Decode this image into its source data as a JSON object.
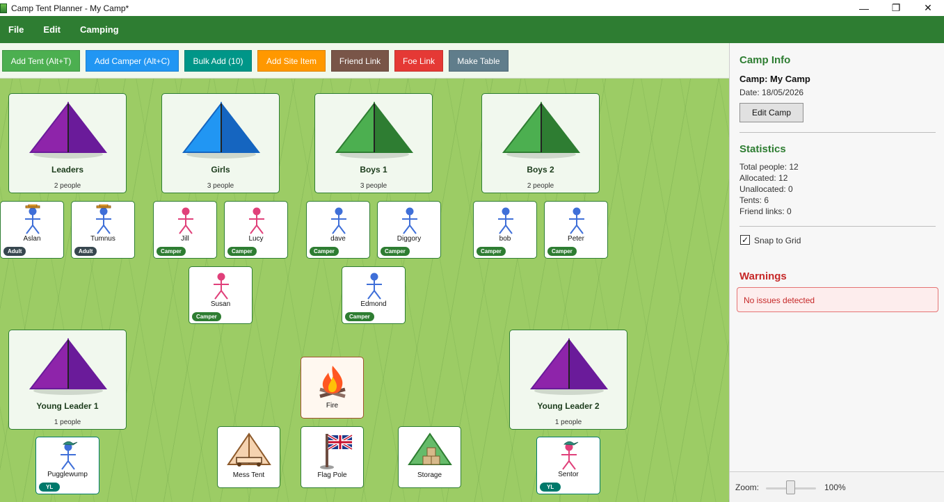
{
  "window": {
    "title": "Camp Tent Planner - My Camp*",
    "controls": [
      "—",
      "❐",
      "✕"
    ]
  },
  "menu": [
    "File",
    "Edit",
    "Camping"
  ],
  "toolbar": [
    {
      "label": "Add Tent (Alt+T)",
      "color": "#4caf50"
    },
    {
      "label": "Add Camper (Alt+C)",
      "color": "#2196f3"
    },
    {
      "label": "Bulk Add (10)",
      "color": "#009688"
    },
    {
      "label": "Add Site Item",
      "color": "#ff9800"
    },
    {
      "label": "Friend Link",
      "color": "#795548"
    },
    {
      "label": "Foe Link",
      "color": "#e53935"
    },
    {
      "label": "Make Table",
      "color": "#607d8b"
    }
  ],
  "tents": [
    {
      "name": "Leaders",
      "count": "2 people",
      "color": "#8e24aa",
      "dark": "#6a1b9a"
    },
    {
      "name": "Girls",
      "count": "3 people",
      "color": "#2196f3",
      "dark": "#1565c0"
    },
    {
      "name": "Boys 1",
      "count": "3 people",
      "color": "#4caf50",
      "dark": "#2e7d32"
    },
    {
      "name": "Boys 2",
      "count": "2 people",
      "color": "#4caf50",
      "dark": "#2e7d32"
    },
    {
      "name": "Young Leader 1",
      "count": "1 people",
      "color": "#8e24aa",
      "dark": "#6a1b9a"
    },
    {
      "name": "Young Leader 2",
      "count": "1 people",
      "color": "#8e24aa",
      "dark": "#6a1b9a"
    }
  ],
  "campers": [
    {
      "name": "Aslan",
      "badge": "Adult",
      "gender": "m",
      "hat": "ranger"
    },
    {
      "name": "Tumnus",
      "badge": "Adult",
      "gender": "m",
      "hat": "ranger"
    },
    {
      "name": "Jill",
      "badge": "Camper",
      "gender": "f",
      "hat": ""
    },
    {
      "name": "Lucy",
      "badge": "Camper",
      "gender": "f",
      "hat": ""
    },
    {
      "name": "dave",
      "badge": "Camper",
      "gender": "m",
      "hat": ""
    },
    {
      "name": "Diggory",
      "badge": "Camper",
      "gender": "m",
      "hat": ""
    },
    {
      "name": "bob",
      "badge": "Camper",
      "gender": "m",
      "hat": ""
    },
    {
      "name": "Peter",
      "badge": "Camper",
      "gender": "m",
      "hat": ""
    },
    {
      "name": "Susan",
      "badge": "Camper",
      "gender": "f",
      "hat": ""
    },
    {
      "name": "Edmond",
      "badge": "Camper",
      "gender": "m",
      "hat": ""
    },
    {
      "name": "Pugglewump",
      "badge": "YL",
      "gender": "m",
      "hat": "cap"
    },
    {
      "name": "Sentor",
      "badge": "YL",
      "gender": "f",
      "hat": "cap"
    }
  ],
  "site_items": [
    {
      "name": "Fire",
      "icon": "campfire-icon"
    },
    {
      "name": "Mess Tent",
      "icon": "mess-tent-icon"
    },
    {
      "name": "Flag Pole",
      "icon": "flag-pole-icon"
    },
    {
      "name": "Storage",
      "icon": "storage-tent-icon"
    }
  ],
  "side": {
    "camp_info_title": "Camp Info",
    "camp_name": "Camp: My Camp",
    "date": "Date: 18/05/2026",
    "edit_camp": "Edit Camp",
    "statistics_title": "Statistics",
    "stats": [
      "Total people: 12",
      "Allocated: 12",
      "Unallocated: 0",
      "Tents: 6",
      "Friend links: 0"
    ],
    "snap_label": "Snap to Grid",
    "snap_checked": "✓",
    "warnings_title": "Warnings",
    "warning_text": "No issues detected",
    "zoom_label": "Zoom:",
    "zoom_value": "100%"
  },
  "colors": {
    "accent": "#2e7d32",
    "grass": "#9ccc65",
    "male": "#3f6fd8",
    "female": "#e0407a",
    "badge_adult": "#37474f",
    "badge_camper": "#2e7d32",
    "badge_yl": "#00796b",
    "warning": "#c62828"
  }
}
